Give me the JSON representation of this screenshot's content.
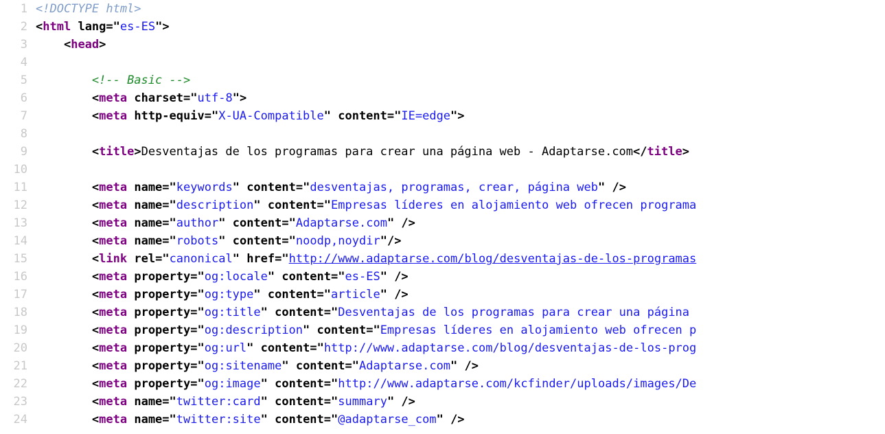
{
  "view": {
    "kind": "browser-view-source",
    "language": "html",
    "background_color": "#ffffff",
    "gutter_color": "#c8c8c8",
    "colors": {
      "doctype": "#7f9dc8",
      "comment": "#1c8a28",
      "tag": "#7c0080",
      "attribute_name": "#000000",
      "attribute_value": "#1a1aee",
      "text": "#000000",
      "punctuation": "#000000"
    }
  },
  "lines": [
    {
      "number": "1",
      "tokens": [
        {
          "t": "doctype",
          "s": "<!DOCTYPE html>"
        }
      ]
    },
    {
      "number": "2",
      "tokens": [
        {
          "t": "punct",
          "s": "<"
        },
        {
          "t": "tag",
          "s": "html"
        },
        {
          "t": "text",
          "s": " "
        },
        {
          "t": "attr",
          "s": "lang"
        },
        {
          "t": "eq",
          "s": "="
        },
        {
          "t": "quote",
          "s": "\""
        },
        {
          "t": "value",
          "s": "es-ES"
        },
        {
          "t": "quote",
          "s": "\""
        },
        {
          "t": "punct",
          "s": ">"
        }
      ]
    },
    {
      "number": "3",
      "tokens": [
        {
          "t": "text",
          "s": "    "
        },
        {
          "t": "punct",
          "s": "<"
        },
        {
          "t": "tag",
          "s": "head"
        },
        {
          "t": "punct",
          "s": ">"
        }
      ]
    },
    {
      "number": "4",
      "tokens": []
    },
    {
      "number": "5",
      "tokens": [
        {
          "t": "text",
          "s": "        "
        },
        {
          "t": "comment",
          "s": "<!-- Basic -->"
        }
      ]
    },
    {
      "number": "6",
      "tokens": [
        {
          "t": "text",
          "s": "        "
        },
        {
          "t": "punct",
          "s": "<"
        },
        {
          "t": "tag",
          "s": "meta"
        },
        {
          "t": "text",
          "s": " "
        },
        {
          "t": "attr",
          "s": "charset"
        },
        {
          "t": "eq",
          "s": "="
        },
        {
          "t": "quote",
          "s": "\""
        },
        {
          "t": "value",
          "s": "utf-8"
        },
        {
          "t": "quote",
          "s": "\""
        },
        {
          "t": "punct",
          "s": ">"
        }
      ]
    },
    {
      "number": "7",
      "tokens": [
        {
          "t": "text",
          "s": "        "
        },
        {
          "t": "punct",
          "s": "<"
        },
        {
          "t": "tag",
          "s": "meta"
        },
        {
          "t": "text",
          "s": " "
        },
        {
          "t": "attr",
          "s": "http-equiv"
        },
        {
          "t": "eq",
          "s": "="
        },
        {
          "t": "quote",
          "s": "\""
        },
        {
          "t": "value",
          "s": "X-UA-Compatible"
        },
        {
          "t": "quote",
          "s": "\""
        },
        {
          "t": "text",
          "s": " "
        },
        {
          "t": "attr",
          "s": "content"
        },
        {
          "t": "eq",
          "s": "="
        },
        {
          "t": "quote",
          "s": "\""
        },
        {
          "t": "value",
          "s": "IE=edge"
        },
        {
          "t": "quote",
          "s": "\""
        },
        {
          "t": "punct",
          "s": ">"
        }
      ]
    },
    {
      "number": "8",
      "tokens": []
    },
    {
      "number": "9",
      "tokens": [
        {
          "t": "text",
          "s": "        "
        },
        {
          "t": "punct",
          "s": "<"
        },
        {
          "t": "tag",
          "s": "title"
        },
        {
          "t": "punct",
          "s": ">"
        },
        {
          "t": "text",
          "s": "Desventajas de los programas para crear una página web - Adaptarse.com"
        },
        {
          "t": "punct",
          "s": "</"
        },
        {
          "t": "tag",
          "s": "title"
        },
        {
          "t": "punct",
          "s": ">"
        }
      ]
    },
    {
      "number": "10",
      "tokens": []
    },
    {
      "number": "11",
      "tokens": [
        {
          "t": "text",
          "s": "        "
        },
        {
          "t": "punct",
          "s": "<"
        },
        {
          "t": "tag",
          "s": "meta"
        },
        {
          "t": "text",
          "s": " "
        },
        {
          "t": "attr",
          "s": "name"
        },
        {
          "t": "eq",
          "s": "="
        },
        {
          "t": "quote",
          "s": "\""
        },
        {
          "t": "value",
          "s": "keywords"
        },
        {
          "t": "quote",
          "s": "\""
        },
        {
          "t": "text",
          "s": " "
        },
        {
          "t": "attr",
          "s": "content"
        },
        {
          "t": "eq",
          "s": "="
        },
        {
          "t": "quote",
          "s": "\""
        },
        {
          "t": "value",
          "s": "desventajas, programas, crear, página web"
        },
        {
          "t": "quote",
          "s": "\""
        },
        {
          "t": "punct",
          "s": " />"
        }
      ]
    },
    {
      "number": "12",
      "tokens": [
        {
          "t": "text",
          "s": "        "
        },
        {
          "t": "punct",
          "s": "<"
        },
        {
          "t": "tag",
          "s": "meta"
        },
        {
          "t": "text",
          "s": " "
        },
        {
          "t": "attr",
          "s": "name"
        },
        {
          "t": "eq",
          "s": "="
        },
        {
          "t": "quote",
          "s": "\""
        },
        {
          "t": "value",
          "s": "description"
        },
        {
          "t": "quote",
          "s": "\""
        },
        {
          "t": "text",
          "s": " "
        },
        {
          "t": "attr",
          "s": "content"
        },
        {
          "t": "eq",
          "s": "="
        },
        {
          "t": "quote",
          "s": "\""
        },
        {
          "t": "value",
          "s": "Empresas líderes en alojamiento web ofrecen programa"
        },
        {
          "t": "quote",
          "s": ""
        }
      ]
    },
    {
      "number": "13",
      "tokens": [
        {
          "t": "text",
          "s": "        "
        },
        {
          "t": "punct",
          "s": "<"
        },
        {
          "t": "tag",
          "s": "meta"
        },
        {
          "t": "text",
          "s": " "
        },
        {
          "t": "attr",
          "s": "name"
        },
        {
          "t": "eq",
          "s": "="
        },
        {
          "t": "quote",
          "s": "\""
        },
        {
          "t": "value",
          "s": "author"
        },
        {
          "t": "quote",
          "s": "\""
        },
        {
          "t": "text",
          "s": " "
        },
        {
          "t": "attr",
          "s": "content"
        },
        {
          "t": "eq",
          "s": "="
        },
        {
          "t": "quote",
          "s": "\""
        },
        {
          "t": "value",
          "s": "Adaptarse.com"
        },
        {
          "t": "quote",
          "s": "\""
        },
        {
          "t": "punct",
          "s": " />"
        }
      ]
    },
    {
      "number": "14",
      "tokens": [
        {
          "t": "text",
          "s": "        "
        },
        {
          "t": "punct",
          "s": "<"
        },
        {
          "t": "tag",
          "s": "meta"
        },
        {
          "t": "text",
          "s": " "
        },
        {
          "t": "attr",
          "s": "name"
        },
        {
          "t": "eq",
          "s": "="
        },
        {
          "t": "quote",
          "s": "\""
        },
        {
          "t": "value",
          "s": "robots"
        },
        {
          "t": "quote",
          "s": "\""
        },
        {
          "t": "text",
          "s": " "
        },
        {
          "t": "attr",
          "s": "content"
        },
        {
          "t": "eq",
          "s": "="
        },
        {
          "t": "quote",
          "s": "\""
        },
        {
          "t": "value",
          "s": "noodp,noydir"
        },
        {
          "t": "quote",
          "s": "\""
        },
        {
          "t": "punct",
          "s": "/>"
        }
      ]
    },
    {
      "number": "15",
      "tokens": [
        {
          "t": "text",
          "s": "        "
        },
        {
          "t": "punct",
          "s": "<"
        },
        {
          "t": "tag",
          "s": "link"
        },
        {
          "t": "text",
          "s": " "
        },
        {
          "t": "attr",
          "s": "rel"
        },
        {
          "t": "eq",
          "s": "="
        },
        {
          "t": "quote",
          "s": "\""
        },
        {
          "t": "value",
          "s": "canonical"
        },
        {
          "t": "quote",
          "s": "\""
        },
        {
          "t": "text",
          "s": " "
        },
        {
          "t": "attr",
          "s": "href"
        },
        {
          "t": "eq",
          "s": "="
        },
        {
          "t": "quote",
          "s": "\""
        },
        {
          "t": "link",
          "s": "http://www.adaptarse.com/blog/desventajas-de-los-programas"
        }
      ]
    },
    {
      "number": "16",
      "tokens": [
        {
          "t": "text",
          "s": "        "
        },
        {
          "t": "punct",
          "s": "<"
        },
        {
          "t": "tag",
          "s": "meta"
        },
        {
          "t": "text",
          "s": " "
        },
        {
          "t": "attr",
          "s": "property"
        },
        {
          "t": "eq",
          "s": "="
        },
        {
          "t": "quote",
          "s": "\""
        },
        {
          "t": "value",
          "s": "og:locale"
        },
        {
          "t": "quote",
          "s": "\""
        },
        {
          "t": "text",
          "s": " "
        },
        {
          "t": "attr",
          "s": "content"
        },
        {
          "t": "eq",
          "s": "="
        },
        {
          "t": "quote",
          "s": "\""
        },
        {
          "t": "value",
          "s": "es-ES"
        },
        {
          "t": "quote",
          "s": "\""
        },
        {
          "t": "punct",
          "s": " />"
        }
      ]
    },
    {
      "number": "17",
      "tokens": [
        {
          "t": "text",
          "s": "        "
        },
        {
          "t": "punct",
          "s": "<"
        },
        {
          "t": "tag",
          "s": "meta"
        },
        {
          "t": "text",
          "s": " "
        },
        {
          "t": "attr",
          "s": "property"
        },
        {
          "t": "eq",
          "s": "="
        },
        {
          "t": "quote",
          "s": "\""
        },
        {
          "t": "value",
          "s": "og:type"
        },
        {
          "t": "quote",
          "s": "\""
        },
        {
          "t": "text",
          "s": " "
        },
        {
          "t": "attr",
          "s": "content"
        },
        {
          "t": "eq",
          "s": "="
        },
        {
          "t": "quote",
          "s": "\""
        },
        {
          "t": "value",
          "s": "article"
        },
        {
          "t": "quote",
          "s": "\""
        },
        {
          "t": "punct",
          "s": " />"
        }
      ]
    },
    {
      "number": "18",
      "tokens": [
        {
          "t": "text",
          "s": "        "
        },
        {
          "t": "punct",
          "s": "<"
        },
        {
          "t": "tag",
          "s": "meta"
        },
        {
          "t": "text",
          "s": " "
        },
        {
          "t": "attr",
          "s": "property"
        },
        {
          "t": "eq",
          "s": "="
        },
        {
          "t": "quote",
          "s": "\""
        },
        {
          "t": "value",
          "s": "og:title"
        },
        {
          "t": "quote",
          "s": "\""
        },
        {
          "t": "text",
          "s": " "
        },
        {
          "t": "attr",
          "s": "content"
        },
        {
          "t": "eq",
          "s": "="
        },
        {
          "t": "quote",
          "s": "\""
        },
        {
          "t": "value",
          "s": "Desventajas de los programas para crear una página "
        }
      ]
    },
    {
      "number": "19",
      "tokens": [
        {
          "t": "text",
          "s": "        "
        },
        {
          "t": "punct",
          "s": "<"
        },
        {
          "t": "tag",
          "s": "meta"
        },
        {
          "t": "text",
          "s": " "
        },
        {
          "t": "attr",
          "s": "property"
        },
        {
          "t": "eq",
          "s": "="
        },
        {
          "t": "quote",
          "s": "\""
        },
        {
          "t": "value",
          "s": "og:description"
        },
        {
          "t": "quote",
          "s": "\""
        },
        {
          "t": "text",
          "s": " "
        },
        {
          "t": "attr",
          "s": "content"
        },
        {
          "t": "eq",
          "s": "="
        },
        {
          "t": "quote",
          "s": "\""
        },
        {
          "t": "value",
          "s": "Empresas líderes en alojamiento web ofrecen p"
        }
      ]
    },
    {
      "number": "20",
      "tokens": [
        {
          "t": "text",
          "s": "        "
        },
        {
          "t": "punct",
          "s": "<"
        },
        {
          "t": "tag",
          "s": "meta"
        },
        {
          "t": "text",
          "s": " "
        },
        {
          "t": "attr",
          "s": "property"
        },
        {
          "t": "eq",
          "s": "="
        },
        {
          "t": "quote",
          "s": "\""
        },
        {
          "t": "value",
          "s": "og:url"
        },
        {
          "t": "quote",
          "s": "\""
        },
        {
          "t": "text",
          "s": " "
        },
        {
          "t": "attr",
          "s": "content"
        },
        {
          "t": "eq",
          "s": "="
        },
        {
          "t": "quote",
          "s": "\""
        },
        {
          "t": "value",
          "s": "http://www.adaptarse.com/blog/desventajas-de-los-prog"
        }
      ]
    },
    {
      "number": "21",
      "tokens": [
        {
          "t": "text",
          "s": "        "
        },
        {
          "t": "punct",
          "s": "<"
        },
        {
          "t": "tag",
          "s": "meta"
        },
        {
          "t": "text",
          "s": " "
        },
        {
          "t": "attr",
          "s": "property"
        },
        {
          "t": "eq",
          "s": "="
        },
        {
          "t": "quote",
          "s": "\""
        },
        {
          "t": "value",
          "s": "og:sitename"
        },
        {
          "t": "quote",
          "s": "\""
        },
        {
          "t": "text",
          "s": " "
        },
        {
          "t": "attr",
          "s": "content"
        },
        {
          "t": "eq",
          "s": "="
        },
        {
          "t": "quote",
          "s": "\""
        },
        {
          "t": "value",
          "s": "Adaptarse.com"
        },
        {
          "t": "quote",
          "s": "\""
        },
        {
          "t": "punct",
          "s": " />"
        }
      ]
    },
    {
      "number": "22",
      "tokens": [
        {
          "t": "text",
          "s": "        "
        },
        {
          "t": "punct",
          "s": "<"
        },
        {
          "t": "tag",
          "s": "meta"
        },
        {
          "t": "text",
          "s": " "
        },
        {
          "t": "attr",
          "s": "property"
        },
        {
          "t": "eq",
          "s": "="
        },
        {
          "t": "quote",
          "s": "\""
        },
        {
          "t": "value",
          "s": "og:image"
        },
        {
          "t": "quote",
          "s": "\""
        },
        {
          "t": "text",
          "s": " "
        },
        {
          "t": "attr",
          "s": "content"
        },
        {
          "t": "eq",
          "s": "="
        },
        {
          "t": "quote",
          "s": "\""
        },
        {
          "t": "value",
          "s": "http://www.adaptarse.com/kcfinder/uploads/images/De"
        }
      ]
    },
    {
      "number": "23",
      "tokens": [
        {
          "t": "text",
          "s": "        "
        },
        {
          "t": "punct",
          "s": "<"
        },
        {
          "t": "tag",
          "s": "meta"
        },
        {
          "t": "text",
          "s": " "
        },
        {
          "t": "attr",
          "s": "name"
        },
        {
          "t": "eq",
          "s": "="
        },
        {
          "t": "quote",
          "s": "\""
        },
        {
          "t": "value",
          "s": "twitter:card"
        },
        {
          "t": "quote",
          "s": "\""
        },
        {
          "t": "text",
          "s": " "
        },
        {
          "t": "attr",
          "s": "content"
        },
        {
          "t": "eq",
          "s": "="
        },
        {
          "t": "quote",
          "s": "\""
        },
        {
          "t": "value",
          "s": "summary"
        },
        {
          "t": "quote",
          "s": "\""
        },
        {
          "t": "punct",
          "s": " />"
        }
      ]
    },
    {
      "number": "24",
      "tokens": [
        {
          "t": "text",
          "s": "        "
        },
        {
          "t": "punct",
          "s": "<"
        },
        {
          "t": "tag",
          "s": "meta"
        },
        {
          "t": "text",
          "s": " "
        },
        {
          "t": "attr",
          "s": "name"
        },
        {
          "t": "eq",
          "s": "="
        },
        {
          "t": "quote",
          "s": "\""
        },
        {
          "t": "value",
          "s": "twitter:site"
        },
        {
          "t": "quote",
          "s": "\""
        },
        {
          "t": "text",
          "s": " "
        },
        {
          "t": "attr",
          "s": "content"
        },
        {
          "t": "eq",
          "s": "="
        },
        {
          "t": "quote",
          "s": "\""
        },
        {
          "t": "value",
          "s": "@adaptarse_com"
        },
        {
          "t": "quote",
          "s": "\""
        },
        {
          "t": "punct",
          "s": " />"
        }
      ]
    }
  ]
}
